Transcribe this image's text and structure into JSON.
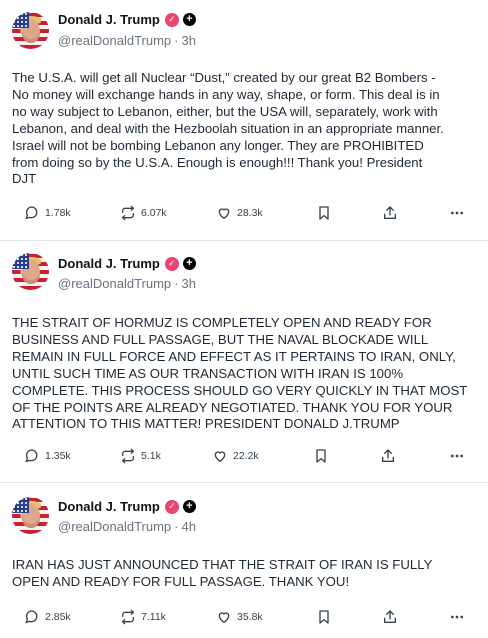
{
  "posts": [
    {
      "author": "Donald J. Trump",
      "handle": "@realDonaldTrump",
      "separator": "·",
      "time": "3h",
      "text": "The U.S.A. will get all Nuclear “Dust,” created by our great B2 Bombers -\nNo money will exchange hands in any way, shape, or form. This deal is in\nno way subject to Lebanon, either, but the USA will, separately, work with\nLebanon, and deal with the Hezboolah situation in an appropriate manner.\nIsrael will not be bombing Lebanon any longer. They are PROHIBITED\nfrom doing so by the U.S.A. Enough is enough!!! Thank you! President\nDJT",
      "replies": "1.78k",
      "reposts": "6.07k",
      "likes": "28.3k"
    },
    {
      "author": "Donald J. Trump",
      "handle": "@realDonaldTrump",
      "separator": "·",
      "time": "3h",
      "text": "THE STRAIT OF HORMUZ IS COMPLETELY OPEN AND READY FOR\nBUSINESS AND FULL PASSAGE, BUT THE NAVAL BLOCKADE WILL\nREMAIN IN FULL FORCE AND EFFECT AS IT PERTAINS TO IRAN, ONLY,\nUNTIL SUCH TIME AS OUR TRANSACTION WITH IRAN IS 100%\nCOMPLETE. THIS PROCESS SHOULD GO VERY QUICKLY IN THAT MOST\nOF THE POINTS ARE ALREADY NEGOTIATED. THANK YOU FOR YOUR\nATTENTION TO THIS MATTER! PRESIDENT DONALD J.TRUMP",
      "replies": "1.35k",
      "reposts": "5.1k",
      "likes": "22.2k"
    },
    {
      "author": "Donald J. Trump",
      "handle": "@realDonaldTrump",
      "separator": "·",
      "time": "4h",
      "text": "IRAN HAS JUST ANNOUNCED THAT THE STRAIT OF IRAN IS FULLY\nOPEN AND READY FOR FULL PASSAGE. THANK YOU!",
      "replies": "2.85k",
      "reposts": "7.11k",
      "likes": "35.8k"
    }
  ],
  "icons": {
    "verified": "verified-check-icon",
    "follow": "plus-icon",
    "reply": "speech-bubble-icon",
    "repost": "repost-arrows-icon",
    "like": "heart-icon",
    "bookmark": "bookmark-icon",
    "share": "share-upload-icon",
    "more": "ellipsis-icon"
  },
  "colors": {
    "verified_badge": "#e8456f",
    "muted_text": "#6b7280"
  }
}
